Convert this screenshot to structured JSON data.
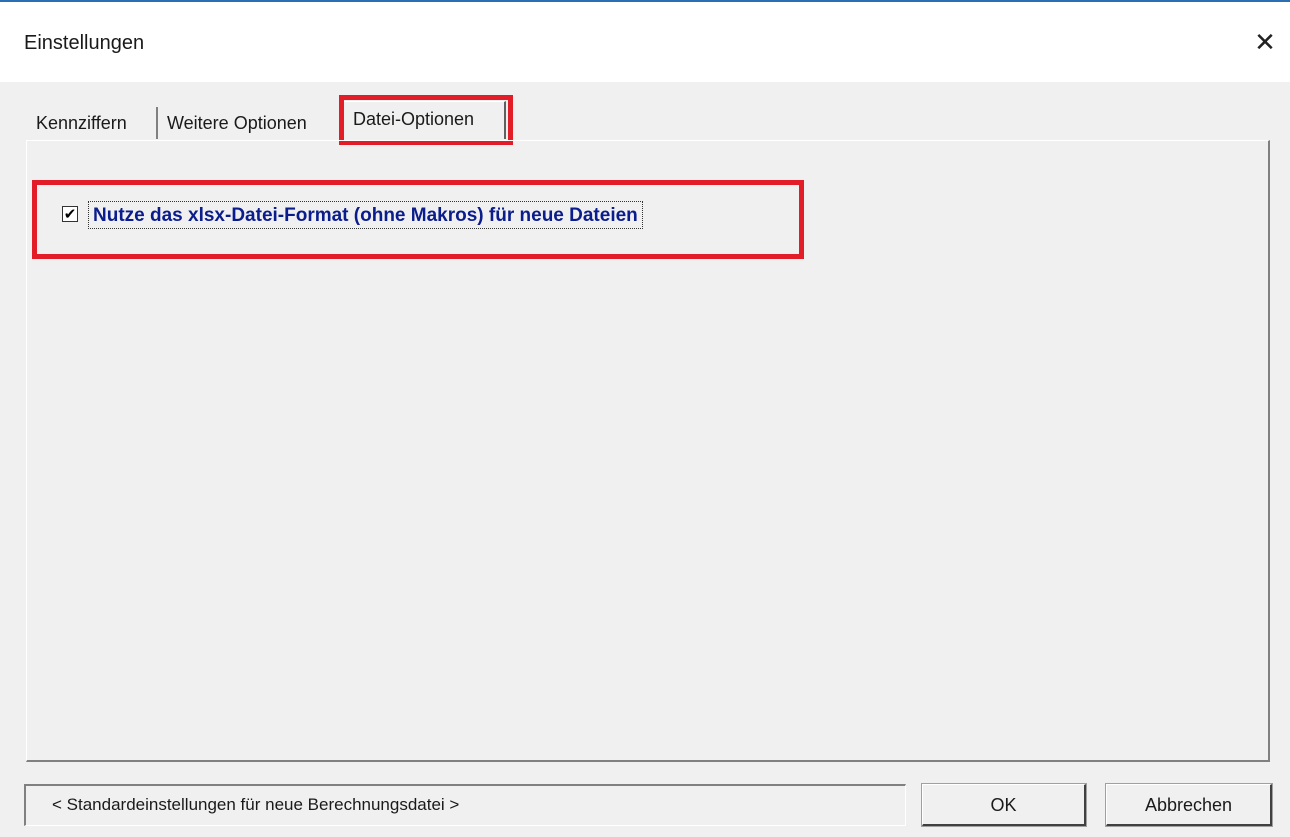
{
  "window": {
    "title": "Einstellungen",
    "close_glyph": "✕"
  },
  "tabs": [
    {
      "label": "Kennziffern",
      "active": false
    },
    {
      "label": "Weitere Optionen",
      "active": false
    },
    {
      "label": "Datei-Optionen",
      "active": true
    }
  ],
  "datei_optionen": {
    "xlsx_checkbox": {
      "checked": true,
      "check_glyph": "✔",
      "label": "Nutze das xlsx-Datei-Format (ohne Makros) für neue Dateien"
    }
  },
  "footer": {
    "status_text": "< Standardeinstellungen für neue Berechnungsdatei >",
    "ok_label": "OK",
    "cancel_label": "Abbrechen"
  },
  "colors": {
    "highlight": "#e21d27",
    "option_label": "#0b1d8c",
    "title_accent": "#2b6fb3"
  }
}
